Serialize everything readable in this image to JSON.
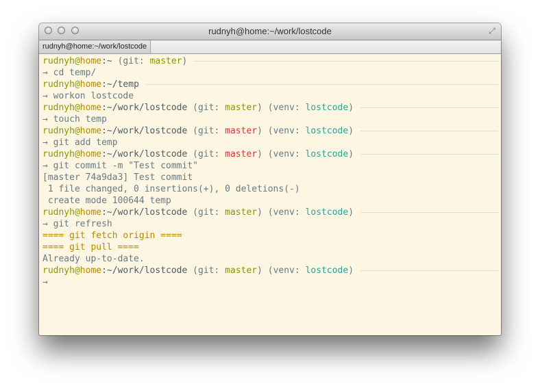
{
  "window": {
    "title": "rudnyh@home:~/work/lostcode",
    "tab_label": "rudnyh@home:~/work/lostcode",
    "buttons": {
      "close": "close-button",
      "minimize": "minimize-button",
      "zoom": "zoom-button",
      "fullscreen": "fullscreen-icon"
    }
  },
  "colors": {
    "background": "#fdf6e3",
    "user": "#859900",
    "host": "#b58900",
    "branch_clean": "#859900",
    "branch_dirty": "#dc322f",
    "venv": "#2aa198",
    "text": "#657b83"
  },
  "terminal": {
    "lines": [
      {
        "type": "prompt",
        "user": "rudnyh",
        "at": "@",
        "host": "home",
        "path": ":~",
        "git_prefix": " (git: ",
        "branch": "master",
        "branch_state": "clean",
        "git_suffix": ")",
        "venv_prefix": "",
        "venv": "",
        "venv_suffix": ""
      },
      {
        "type": "command",
        "arrow": "→",
        "text": " cd temp/"
      },
      {
        "type": "prompt",
        "user": "rudnyh",
        "at": "@",
        "host": "home",
        "path": ":~/temp",
        "git_prefix": "",
        "branch": "",
        "branch_state": "",
        "git_suffix": "",
        "venv_prefix": "",
        "venv": "",
        "venv_suffix": ""
      },
      {
        "type": "command",
        "arrow": "→",
        "text": " workon lostcode"
      },
      {
        "type": "prompt",
        "user": "rudnyh",
        "at": "@",
        "host": "home",
        "path": ":~/work/lostcode",
        "git_prefix": " (git: ",
        "branch": "master",
        "branch_state": "clean",
        "git_suffix": ")",
        "venv_prefix": " (venv: ",
        "venv": "lostcode",
        "venv_suffix": ")"
      },
      {
        "type": "command",
        "arrow": "→",
        "text": " touch temp"
      },
      {
        "type": "prompt",
        "user": "rudnyh",
        "at": "@",
        "host": "home",
        "path": ":~/work/lostcode",
        "git_prefix": " (git: ",
        "branch": "master",
        "branch_state": "dirty",
        "git_suffix": ")",
        "venv_prefix": " (venv: ",
        "venv": "lostcode",
        "venv_suffix": ")"
      },
      {
        "type": "command",
        "arrow": "→",
        "text": " git add temp"
      },
      {
        "type": "prompt",
        "user": "rudnyh",
        "at": "@",
        "host": "home",
        "path": ":~/work/lostcode",
        "git_prefix": " (git: ",
        "branch": "master",
        "branch_state": "dirty",
        "git_suffix": ")",
        "venv_prefix": " (venv: ",
        "venv": "lostcode",
        "venv_suffix": ")"
      },
      {
        "type": "command",
        "arrow": "→",
        "text": " git commit -m \"Test commit\""
      },
      {
        "type": "output",
        "text": "[master 74a9da3] Test commit"
      },
      {
        "type": "output",
        "text": " 1 file changed, 0 insertions(+), 0 deletions(-)"
      },
      {
        "type": "output",
        "text": " create mode 100644 temp"
      },
      {
        "type": "prompt",
        "user": "rudnyh",
        "at": "@",
        "host": "home",
        "path": ":~/work/lostcode",
        "git_prefix": " (git: ",
        "branch": "master",
        "branch_state": "clean",
        "git_suffix": ")",
        "venv_prefix": " (venv: ",
        "venv": "lostcode",
        "venv_suffix": ")"
      },
      {
        "type": "command",
        "arrow": "→",
        "text": " git refresh"
      },
      {
        "type": "highlight",
        "text": "==== git fetch origin ===="
      },
      {
        "type": "highlight",
        "text": "==== git pull ===="
      },
      {
        "type": "output",
        "text": "Already up-to-date."
      },
      {
        "type": "prompt",
        "user": "rudnyh",
        "at": "@",
        "host": "home",
        "path": ":~/work/lostcode",
        "git_prefix": " (git: ",
        "branch": "master",
        "branch_state": "clean",
        "git_suffix": ")",
        "venv_prefix": " (venv: ",
        "venv": "lostcode",
        "venv_suffix": ")"
      },
      {
        "type": "command",
        "arrow": "→",
        "text": ""
      }
    ]
  }
}
